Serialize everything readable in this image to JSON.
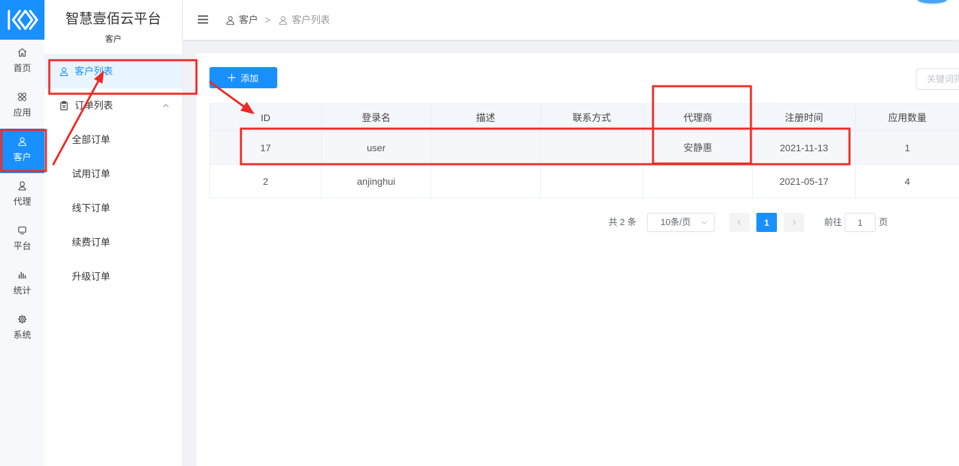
{
  "colors": {
    "accent": "#1890ff",
    "annotation": "#ee2a24"
  },
  "app": {
    "title": "智慧壹佰云平台",
    "section": "客户"
  },
  "icon_nav": [
    {
      "label": "首页",
      "icon": "home-icon"
    },
    {
      "label": "应用",
      "icon": "apps-icon"
    },
    {
      "label": "客户",
      "icon": "user-icon",
      "active": true
    },
    {
      "label": "代理",
      "icon": "agent-icon"
    },
    {
      "label": "平台",
      "icon": "monitor-icon"
    },
    {
      "label": "统计",
      "icon": "bar-chart-icon"
    },
    {
      "label": "系统",
      "icon": "gear-icon"
    }
  ],
  "sub_nav": {
    "items": [
      {
        "label": "客户列表",
        "icon": "user-icon",
        "active": true
      },
      {
        "label": "订单列表",
        "icon": "clipboard-icon",
        "expanded": true,
        "children": [
          "全部订单",
          "试用订单",
          "线下订单",
          "续费订单",
          "升级订单"
        ]
      }
    ]
  },
  "breadcrumb": {
    "items": [
      "客户",
      "客户列表"
    ],
    "separator": ">"
  },
  "toolbar": {
    "add_label": "添加",
    "search_placeholder": "关键词筛"
  },
  "table": {
    "columns": [
      "ID",
      "登录名",
      "描述",
      "联系方式",
      "代理商",
      "注册时间",
      "应用数量"
    ],
    "rows": [
      [
        "17",
        "user",
        "",
        "",
        "安静惠",
        "2021-11-13",
        "1"
      ],
      [
        "2",
        "anjinghui",
        "",
        "",
        "",
        "2021-05-17",
        "4"
      ]
    ]
  },
  "pagination": {
    "total_text": "共 2 条",
    "page_size": "10条/页",
    "current_page": "1",
    "goto_label": "前往",
    "goto_value": "1",
    "page_suffix": "页"
  }
}
